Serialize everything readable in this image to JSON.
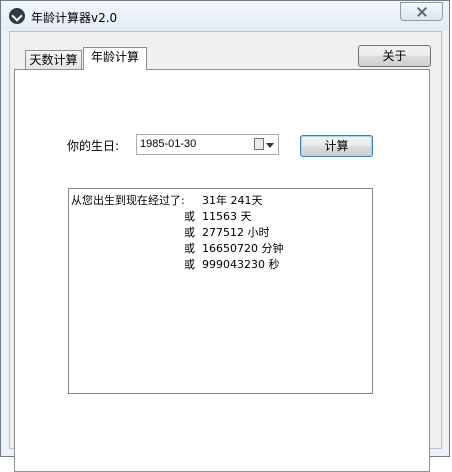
{
  "window": {
    "title": "年龄计算器v2.0"
  },
  "tabs": [
    {
      "label": "天数计算",
      "active": false
    },
    {
      "label": "年龄计算",
      "active": true
    }
  ],
  "about_button": "关于",
  "birthday": {
    "label": "你的生日:",
    "value": "1985-01-30"
  },
  "calc_button": "计算",
  "result": {
    "prefix": "从您出生到现在经过了:",
    "lines": [
      {
        "lead": "",
        "text": "31年 241天"
      },
      {
        "lead": "或",
        "text": "11563 天"
      },
      {
        "lead": "或",
        "text": "277512 小时"
      },
      {
        "lead": "或",
        "text": "16650720 分钟"
      },
      {
        "lead": "或",
        "text": "999043230 秒"
      }
    ]
  },
  "icons": {
    "app": "app-icon",
    "close": "close-icon",
    "calendar": "calendar-icon",
    "dropdown": "dropdown-arrow-icon"
  }
}
